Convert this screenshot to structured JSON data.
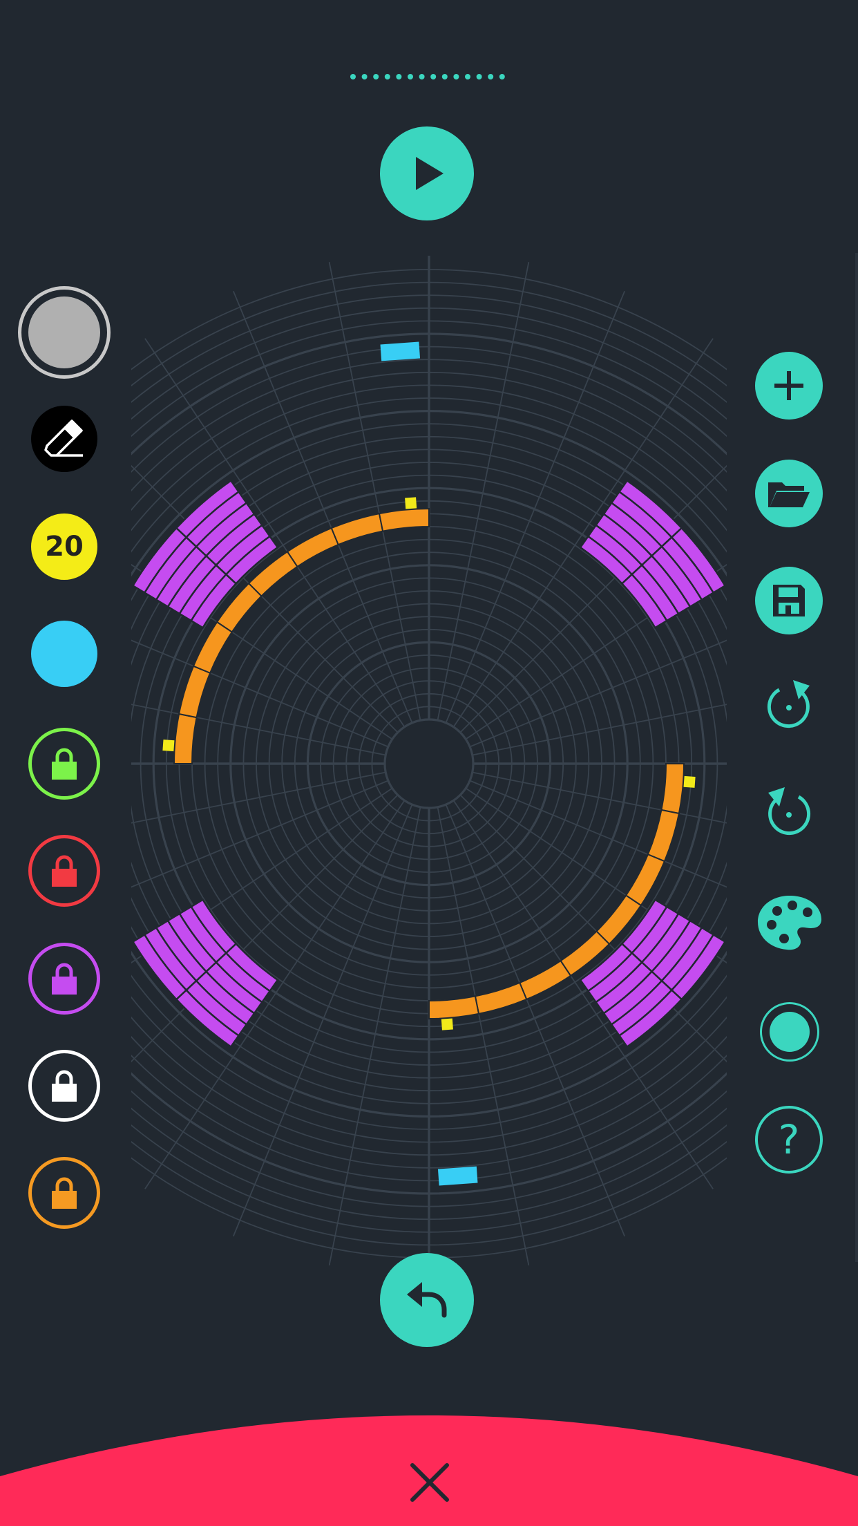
{
  "toolbar_left": {
    "selected_color_swatch": "#b0b0b0",
    "eraser": "eraser-icon",
    "count_badge": "20",
    "color_cyan": "#38cef5",
    "locks": [
      {
        "name": "lock-green",
        "color": "#7cf24a"
      },
      {
        "name": "lock-red",
        "color": "#f23a42"
      },
      {
        "name": "lock-purple",
        "color": "#c54cf0"
      },
      {
        "name": "lock-white",
        "color": "#ffffff"
      },
      {
        "name": "lock-orange",
        "color": "#f59a22"
      }
    ]
  },
  "toolbar_right": {
    "icons": [
      "plus-icon",
      "folder-icon",
      "save-icon",
      "rotate-cw-icon",
      "rotate-ccw-icon",
      "palette-icon",
      "record-icon",
      "help-icon"
    ],
    "help_label": "?"
  },
  "controls": {
    "play": "play-icon",
    "undo": "undo-icon",
    "close": "close-icon"
  },
  "colors": {
    "background": "#212830",
    "grid": "#38424d",
    "teal": "#3bd6bf",
    "orange": "#f6961e",
    "purple": "#c54cf0",
    "cyan": "#38cef5",
    "yellow": "#f2ea1a",
    "close_bar": "#ff2a58"
  },
  "progress_dots": 14
}
